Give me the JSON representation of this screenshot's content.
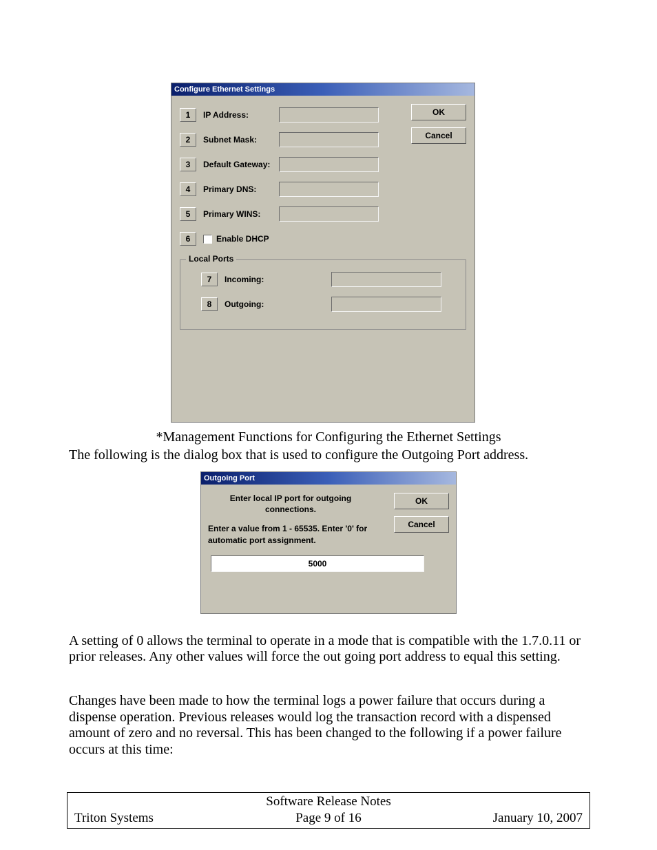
{
  "ethernet_dialog": {
    "title": "Configure Ethernet Settings",
    "rows": [
      {
        "num": "1",
        "label": "IP Address:"
      },
      {
        "num": "2",
        "label": "Subnet Mask:"
      },
      {
        "num": "3",
        "label": "Default Gateway:"
      },
      {
        "num": "4",
        "label": "Primary DNS:"
      },
      {
        "num": "5",
        "label": "Primary WINS:"
      }
    ],
    "dhcp": {
      "num": "6",
      "label": "Enable DHCP"
    },
    "ok": "OK",
    "cancel": "Cancel",
    "local_ports": {
      "legend": "Local Ports",
      "incoming": {
        "num": "7",
        "label": "Incoming:"
      },
      "outgoing": {
        "num": "8",
        "label": "Outgoing:"
      }
    }
  },
  "caption1": "*Management Functions for Configuring the Ethernet Settings",
  "para1": "The following is the dialog box that is used to configure the Outgoing Port address.",
  "outgoing_dialog": {
    "title": "Outgoing Port",
    "line1": "Enter local IP port for outgoing connections.",
    "line2": "Enter a value from 1 - 65535. Enter '0' for automatic port assignment.",
    "value": "5000",
    "ok": "OK",
    "cancel": "Cancel"
  },
  "para2": "A setting of 0 allows the terminal to operate in a mode that is compatible with the 1.7.0.11 or prior releases.  Any other values will force the out going port address to equal this setting.",
  "para3": "Changes have been made to how the terminal logs a power failure that occurs during a dispense operation.  Previous releases would log the transaction record with a dispensed amount of zero and no reversal.  This has been changed to the following if a power failure occurs at this time:",
  "footer": {
    "title": "Software Release Notes",
    "left": "Triton Systems",
    "center": "Page 9 of 16",
    "right": "January 10, 2007"
  }
}
